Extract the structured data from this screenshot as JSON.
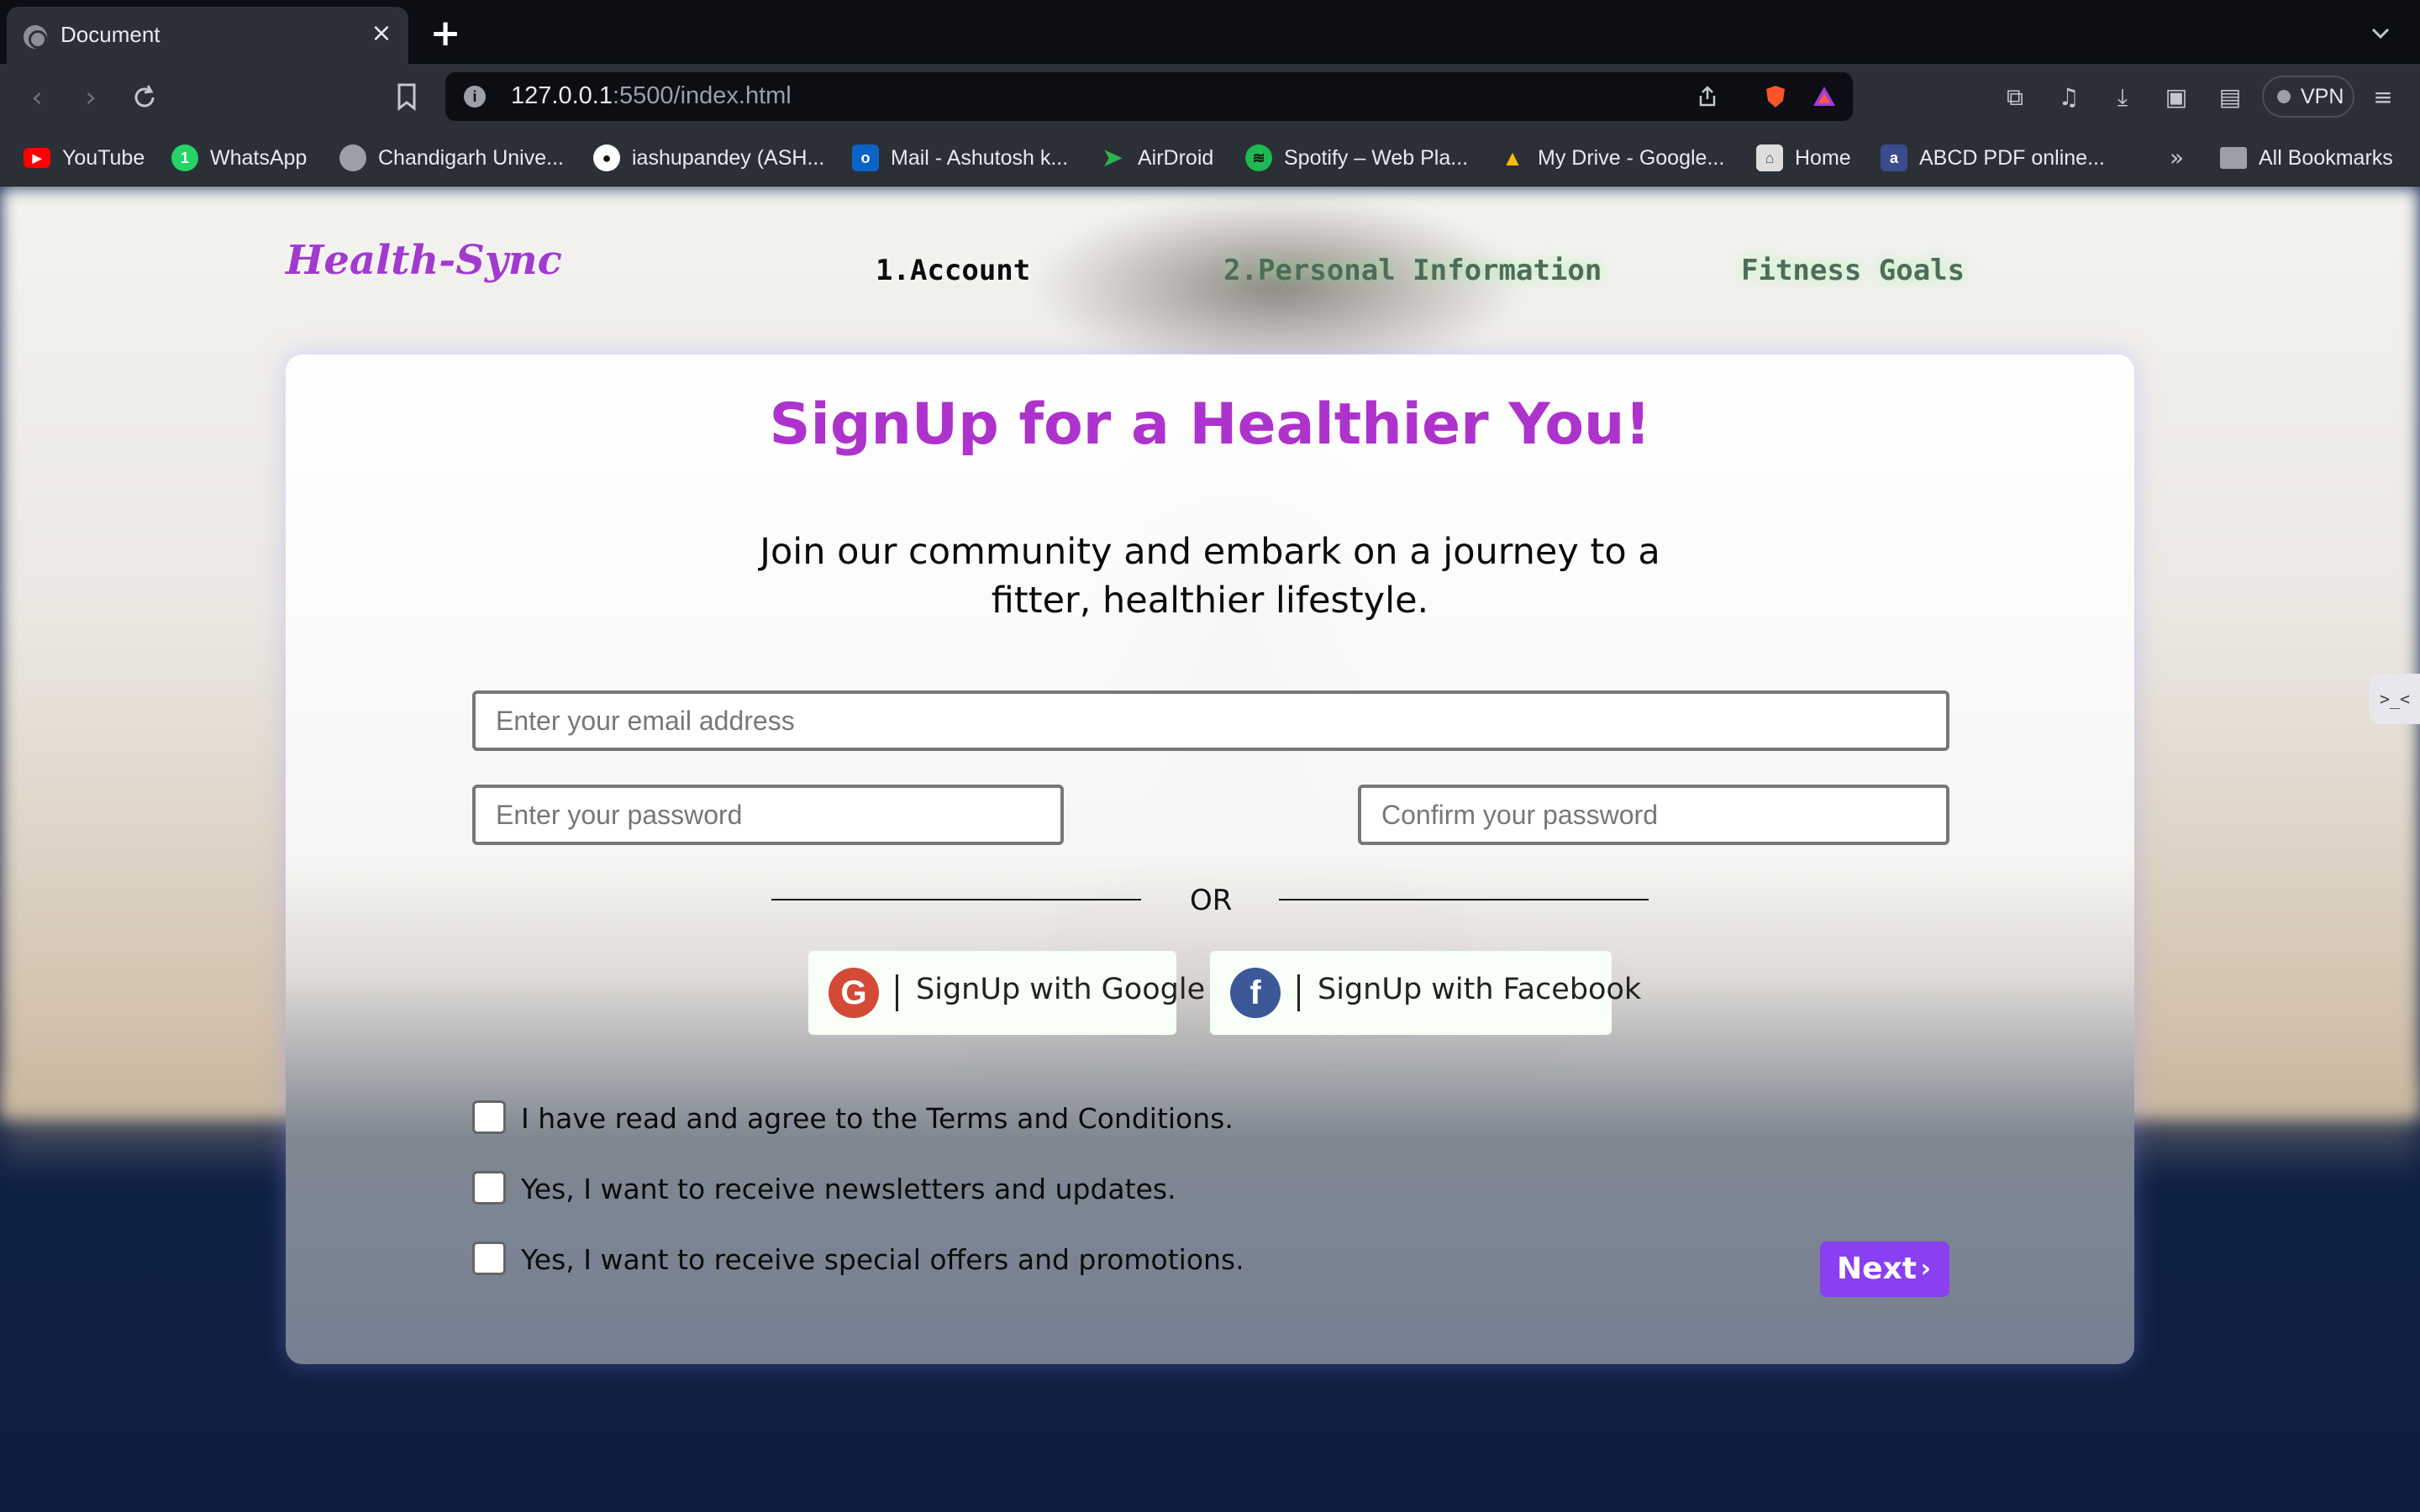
{
  "browser": {
    "tab_title": "Document",
    "url_host": "127.0.0.1",
    "url_rest": ":5500/index.html",
    "vpn_label": "VPN",
    "bookmarks": [
      {
        "label": "YouTube",
        "icon": "youtube-icon",
        "color": "#ff0000"
      },
      {
        "label": "WhatsApp",
        "icon": "whatsapp-icon",
        "color": "#25d366"
      },
      {
        "label": "Chandigarh Unive...",
        "icon": "globe-icon",
        "color": "#9aa0a6"
      },
      {
        "label": "iashupandey (ASH...",
        "icon": "github-icon",
        "color": "#ffffff"
      },
      {
        "label": "Mail - Ashutosh k...",
        "icon": "outlook-icon",
        "color": "#0a64c8"
      },
      {
        "label": "AirDroid",
        "icon": "airdroid-icon",
        "color": "#2fb24c"
      },
      {
        "label": "Spotify – Web Pla...",
        "icon": "spotify-icon",
        "color": "#1db954"
      },
      {
        "label": "My Drive - Google...",
        "icon": "google-drive-icon",
        "color": "#fbbc04"
      },
      {
        "label": "Home",
        "icon": "home-icon",
        "color": "#dddddd"
      },
      {
        "label": "ABCD PDF online...",
        "icon": "pdf-icon",
        "color": "#3b4c8c"
      }
    ],
    "bookmarks_more": "»",
    "all_bookmarks": "All Bookmarks"
  },
  "site": {
    "logo": "Health-Sync",
    "steps": [
      "1.Account",
      "2.Personal Information",
      "Fitness Goals"
    ]
  },
  "form": {
    "title": "SignUp for a Healthier You!",
    "subtitle": "Join our community and embark on a journey to a fitter, healthier lifestyle.",
    "email_placeholder": "Enter your email address",
    "password_placeholder": "Enter your password",
    "confirm_placeholder": "Confirm your password",
    "or_text": "OR",
    "google_label": "SignUp with Google",
    "google_icon_glyph": "G",
    "facebook_label": "SignUp with Facebook",
    "facebook_icon_glyph": "f",
    "checkboxes": [
      "I have read and agree to the Terms and Conditions.",
      "Yes, I want to receive newsletters and updates.",
      "Yes, I want to receive special offers and promotions."
    ],
    "next_label": "Next",
    "next_chevron": "›"
  },
  "colors": {
    "brand_purple": "#ad33cc",
    "next_button": "#8a3ff0",
    "google_red": "#d44a36",
    "facebook_blue": "#3b5998"
  }
}
